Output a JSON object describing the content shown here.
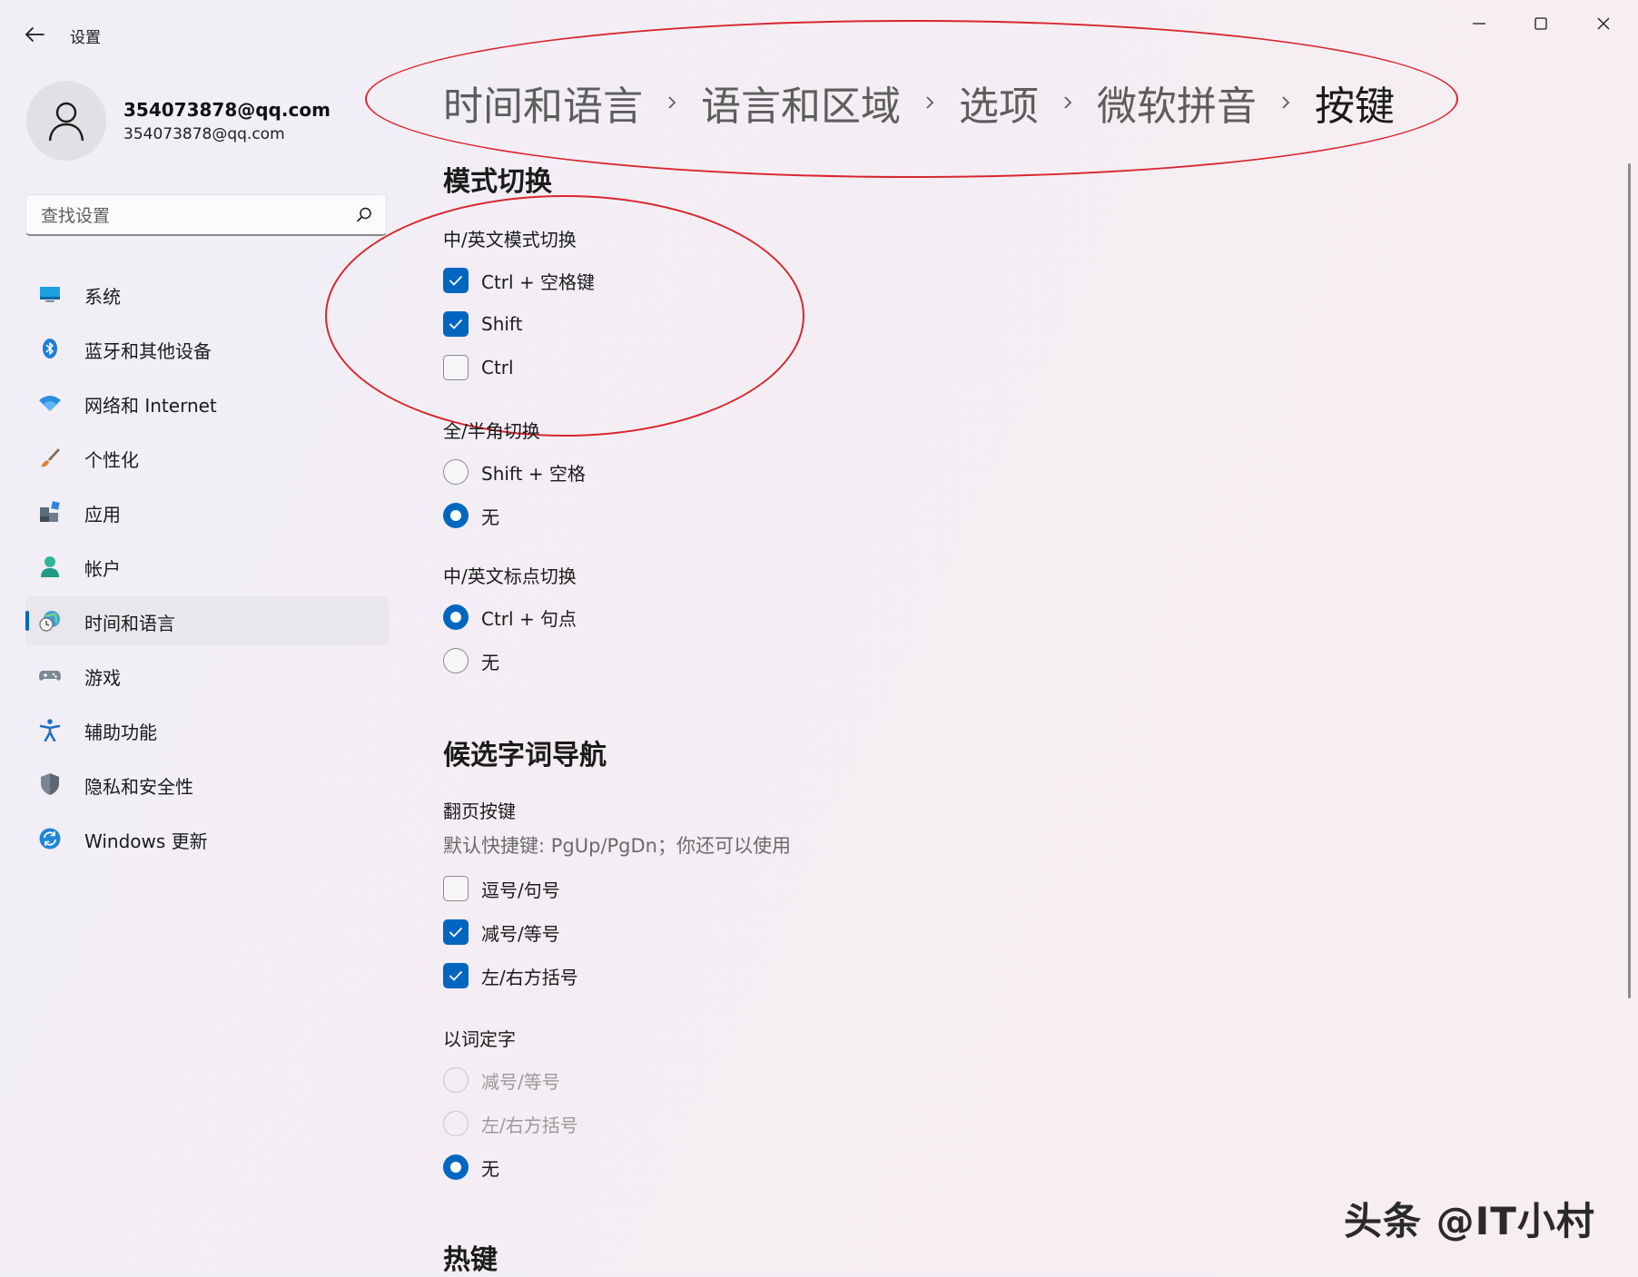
{
  "window": {
    "title": "设置",
    "controls": {
      "minimize": "minimize-icon",
      "maximize": "maximize-icon",
      "close": "close-icon"
    }
  },
  "account": {
    "name": "354073878@qq.com",
    "email": "354073878@qq.com"
  },
  "search": {
    "placeholder": "查找设置"
  },
  "sidebar": {
    "items": [
      {
        "label": "系统",
        "icon": "monitor-icon"
      },
      {
        "label": "蓝牙和其他设备",
        "icon": "bluetooth-icon"
      },
      {
        "label": "网络和 Internet",
        "icon": "wifi-icon"
      },
      {
        "label": "个性化",
        "icon": "brush-icon"
      },
      {
        "label": "应用",
        "icon": "apps-icon"
      },
      {
        "label": "帐户",
        "icon": "account-icon"
      },
      {
        "label": "时间和语言",
        "icon": "globe-clock-icon",
        "active": true
      },
      {
        "label": "游戏",
        "icon": "gamepad-icon"
      },
      {
        "label": "辅助功能",
        "icon": "accessibility-icon"
      },
      {
        "label": "隐私和安全性",
        "icon": "shield-icon"
      },
      {
        "label": "Windows 更新",
        "icon": "update-icon"
      }
    ]
  },
  "breadcrumb": [
    "时间和语言",
    "语言和区域",
    "选项",
    "微软拼音",
    "按键"
  ],
  "mode_switch": {
    "title": "模式切换",
    "cn_en": {
      "label": "中/英文模式切换",
      "options": [
        {
          "label": "Ctrl + 空格键",
          "checked": true
        },
        {
          "label": "Shift",
          "checked": true
        },
        {
          "label": "Ctrl",
          "checked": false
        }
      ]
    },
    "full_half": {
      "label": "全/半角切换",
      "options": [
        {
          "label": "Shift + 空格",
          "selected": false
        },
        {
          "label": "无",
          "selected": true
        }
      ]
    },
    "punct": {
      "label": "中/英文标点切换",
      "options": [
        {
          "label": "Ctrl + 句点",
          "selected": true
        },
        {
          "label": "无",
          "selected": false
        }
      ]
    }
  },
  "candidate_nav": {
    "title": "候选字词导航",
    "page_keys": {
      "label": "翻页按键",
      "hint": "默认快捷键: PgUp/PgDn；你还可以使用",
      "options": [
        {
          "label": "逗号/句号",
          "checked": false
        },
        {
          "label": "减号/等号",
          "checked": true
        },
        {
          "label": "左/右方括号",
          "checked": true
        }
      ]
    },
    "word_to_char": {
      "label": "以词定字",
      "options": [
        {
          "label": "减号/等号",
          "selected": false,
          "disabled": true
        },
        {
          "label": "左/右方括号",
          "selected": false,
          "disabled": true
        },
        {
          "label": "无",
          "selected": true,
          "disabled": false
        }
      ]
    }
  },
  "hotkeys": {
    "title": "热键"
  },
  "watermark": "头条 @IT小村",
  "colors": {
    "accent": "#0067c0",
    "annotation": "#d9262e"
  }
}
